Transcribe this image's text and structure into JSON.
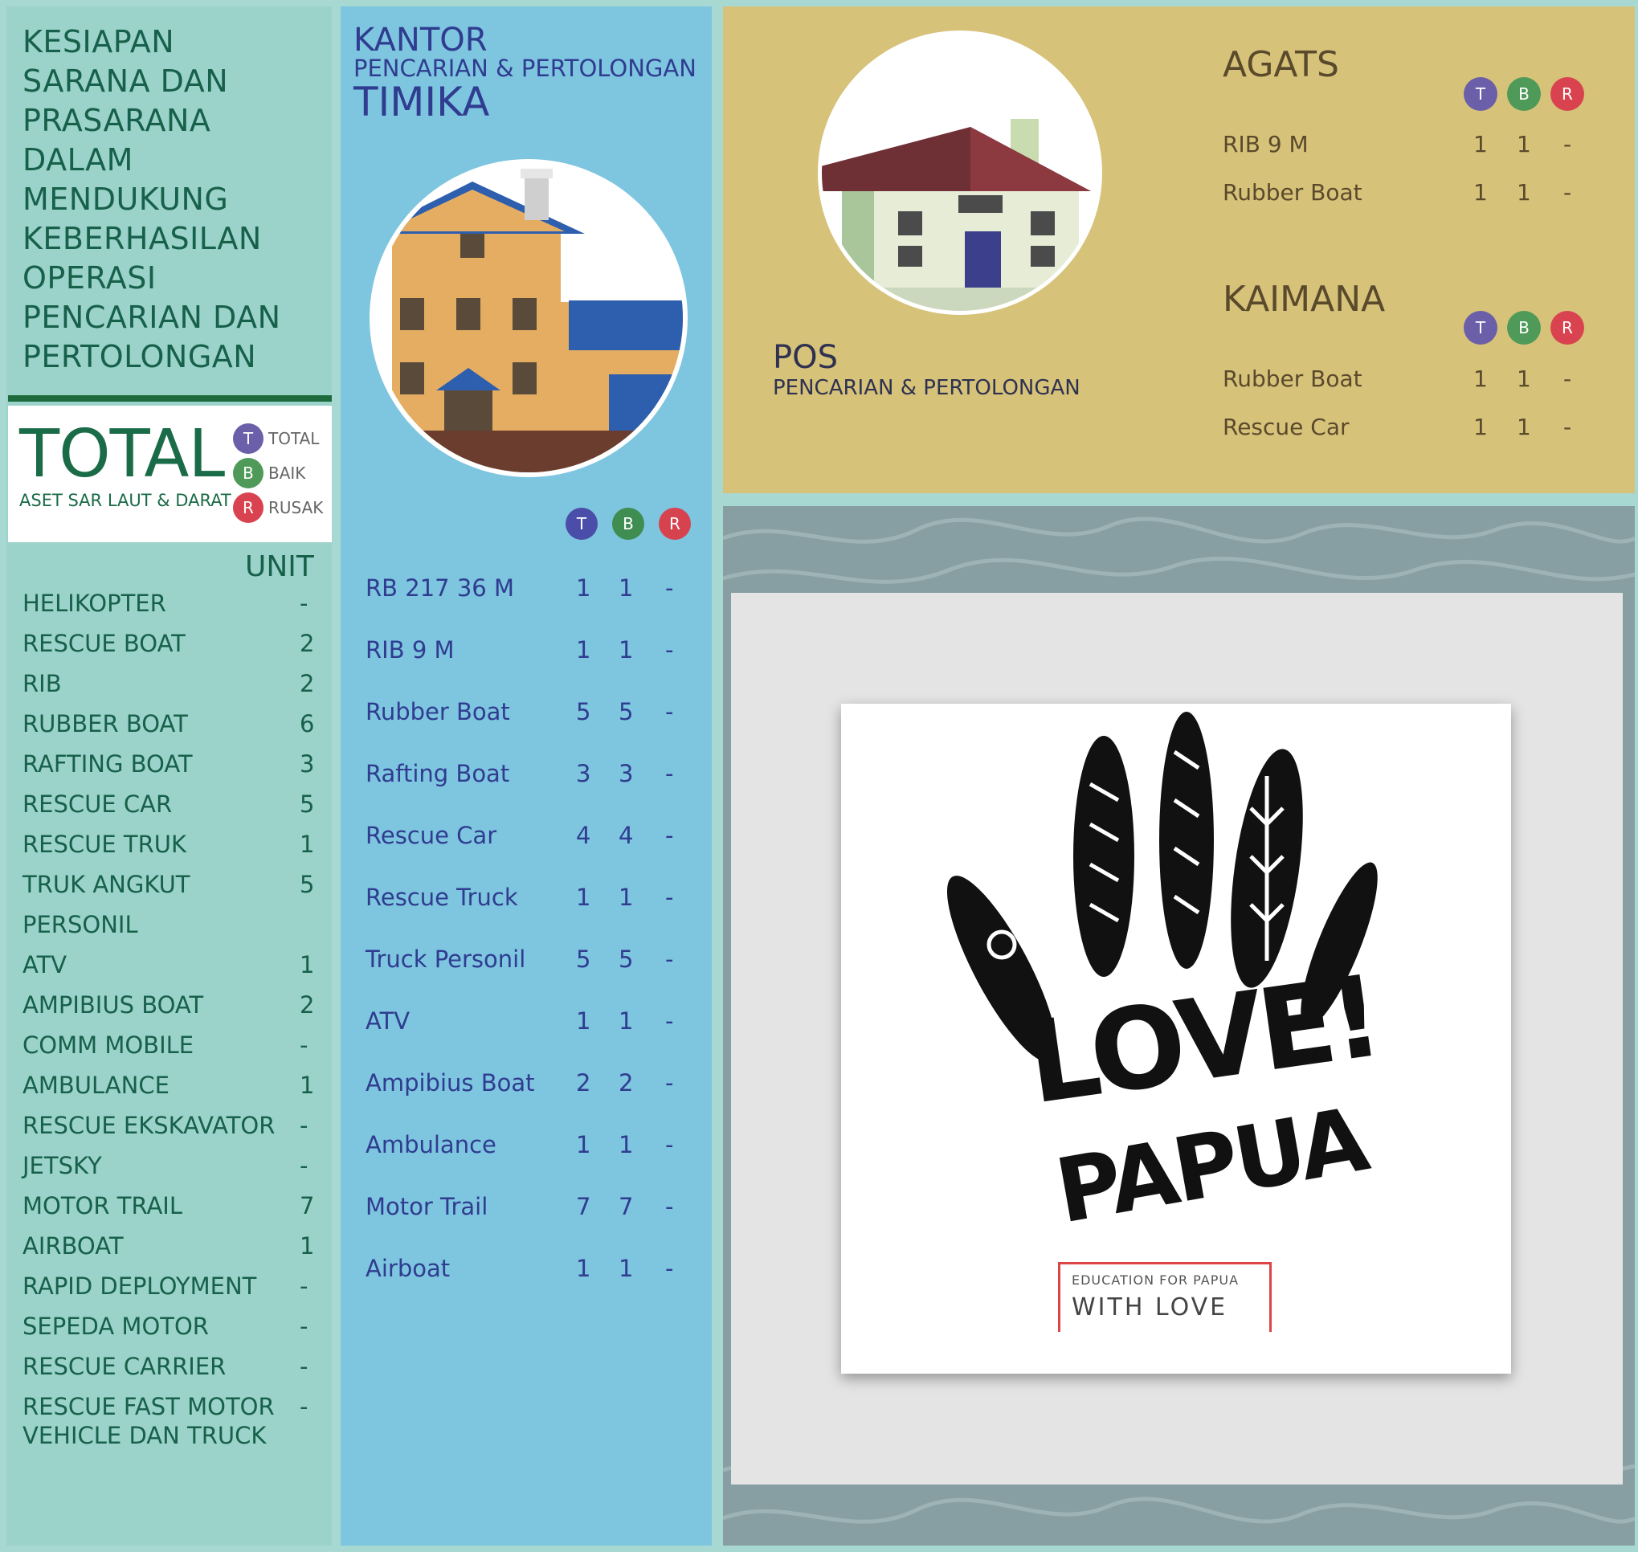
{
  "left": {
    "title_lines": [
      "KESIAPAN",
      "SARANA DAN",
      "PRASARANA",
      "DALAM",
      "MENDUKUNG",
      "KEBERHASILAN",
      "OPERASI",
      "PENCARIAN DAN",
      "PERTOLONGAN"
    ],
    "total_title": "TOTAL",
    "total_sub": "ASET SAR LAUT & DARAT",
    "legend": [
      {
        "letter": "T",
        "label": "TOTAL",
        "color": "#6a5fa8"
      },
      {
        "letter": "B",
        "label": "BAIK",
        "color": "#4f9a58"
      },
      {
        "letter": "R",
        "label": "RUSAK",
        "color": "#d9434f"
      }
    ],
    "unit_header": "UNIT",
    "items": [
      {
        "name": "HELIKOPTER",
        "value": "-"
      },
      {
        "name": "RESCUE BOAT",
        "value": "2"
      },
      {
        "name": "RIB",
        "value": "2"
      },
      {
        "name": "RUBBER BOAT",
        "value": "6"
      },
      {
        "name": "RAFTING BOAT",
        "value": "3"
      },
      {
        "name": "RESCUE CAR",
        "value": "5"
      },
      {
        "name": "RESCUE TRUK",
        "value": "1"
      },
      {
        "name": "TRUK ANGKUT",
        "value": "5"
      },
      {
        "name": "PERSONIL",
        "value": ""
      },
      {
        "name": "ATV",
        "value": "1"
      },
      {
        "name": "AMPIBIUS BOAT",
        "value": "2"
      },
      {
        "name": "COMM MOBILE",
        "value": "-"
      },
      {
        "name": "AMBULANCE",
        "value": "1"
      },
      {
        "name": "RESCUE EKSKAVATOR",
        "value": "-"
      },
      {
        "name": "JETSKY",
        "value": "-"
      },
      {
        "name": "MOTOR TRAIL",
        "value": "7"
      },
      {
        "name": "AIRBOAT",
        "value": "1"
      },
      {
        "name": "RAPID DEPLOYMENT",
        "value": "-"
      },
      {
        "name": "SEPEDA MOTOR",
        "value": "-"
      },
      {
        "name": "RESCUE CARRIER",
        "value": "-"
      },
      {
        "name": "RESCUE FAST MOTOR",
        "value": "-"
      },
      {
        "name": "VEHICLE DAN TRUCK",
        "value": ""
      }
    ]
  },
  "middle": {
    "kantor": "KANTOR",
    "sub": "PENCARIAN  & PERTOLONGAN",
    "city": "TIMIKA",
    "headers": [
      "T",
      "B",
      "R"
    ],
    "rows": [
      {
        "name": "RB 217 36 M",
        "t": "1",
        "b": "1",
        "r": "-"
      },
      {
        "name": "RIB 9 M",
        "t": "1",
        "b": "1",
        "r": "-"
      },
      {
        "name": "Rubber Boat",
        "t": "5",
        "b": "5",
        "r": "-"
      },
      {
        "name": "Rafting Boat",
        "t": "3",
        "b": "3",
        "r": "-"
      },
      {
        "name": "Rescue Car",
        "t": "4",
        "b": "4",
        "r": "-"
      },
      {
        "name": "Rescue Truck",
        "t": "1",
        "b": "1",
        "r": "-"
      },
      {
        "name": "Truck Personil",
        "t": "5",
        "b": "5",
        "r": "-"
      },
      {
        "name": "ATV",
        "t": "1",
        "b": "1",
        "r": "-"
      },
      {
        "name": "Ampibius Boat",
        "t": "2",
        "b": "2",
        "r": "-"
      },
      {
        "name": "Ambulance",
        "t": "1",
        "b": "1",
        "r": "-"
      },
      {
        "name": "Motor Trail",
        "t": "7",
        "b": "7",
        "r": "-"
      },
      {
        "name": "Airboat",
        "t": "1",
        "b": "1",
        "r": "-"
      }
    ]
  },
  "right": {
    "pos": "POS",
    "pos_sub": "PENCARIAN  & PERTOLONGAN",
    "agats": {
      "title": "AGATS",
      "rows": [
        {
          "name": "RIB 9 M",
          "t": "1",
          "b": "1",
          "r": "-"
        },
        {
          "name": "Rubber Boat",
          "t": "1",
          "b": "1",
          "r": "-"
        }
      ]
    },
    "kaimana": {
      "title": "KAIMANA",
      "rows": [
        {
          "name": "Rubber Boat",
          "t": "1",
          "b": "1",
          "r": "-"
        },
        {
          "name": "Rescue Car",
          "t": "1",
          "b": "1",
          "r": "-"
        }
      ]
    },
    "poster": {
      "line1": "LOVE!",
      "line2": "PAPUA",
      "tag1": "EDUCATION FOR PAPUA",
      "tag2": "WITH LOVE"
    }
  }
}
